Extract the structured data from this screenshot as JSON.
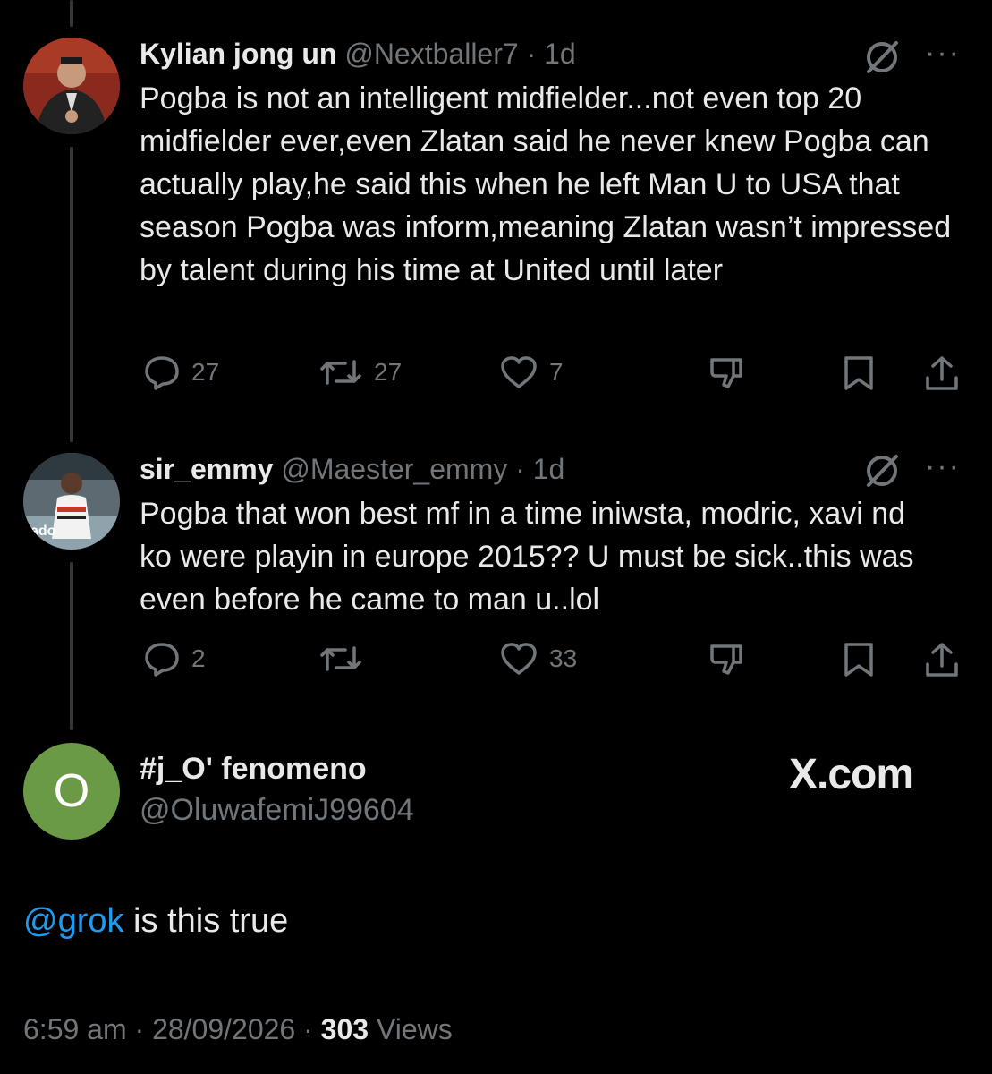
{
  "tweets": [
    {
      "name": "Kylian jong un",
      "handle": "@Nextballer7",
      "time": "· 1d",
      "text": "Pogba is not an intelligent midfielder...not even top 20 midfielder ever,even Zlatan said he never knew Pogba can actually play,he said this when he left Man U to USA that season Pogba was inform,meaning Zlatan wasn’t impressed by talent during his time at United until later",
      "replies": "27",
      "reposts": "27",
      "likes": "7"
    },
    {
      "name": "sir_emmy",
      "handle": "@Maester_emmy",
      "time": "· 1d",
      "text": "Pogba that won best mf in a time iniwsta, modric, xavi nd ko were playin in europe 2015?? U must be sick..this was even before he came to man u..lol",
      "replies": "2",
      "reposts": "",
      "likes": "33"
    }
  ],
  "main_tweet": {
    "avatar_letter": "O",
    "name": "#j_O' fenomeno",
    "handle": "@OluwafemiJ99604",
    "mention": "@grok",
    "text": " is this true",
    "time": "6:59 am",
    "date": "28/09/2026",
    "views_count": "303",
    "views_label": "Views"
  },
  "watermark": "X.com",
  "more_label": "···",
  "icons": [
    "grok-icon",
    "reply-icon",
    "repost-icon",
    "like-icon",
    "dislike-icon",
    "bookmark-icon",
    "share-icon"
  ],
  "colors": {
    "background": "#000000",
    "text": "#e7e9ea",
    "muted": "#71767b",
    "link": "#1d9bf0",
    "avatar_green": "#6a9a46"
  }
}
